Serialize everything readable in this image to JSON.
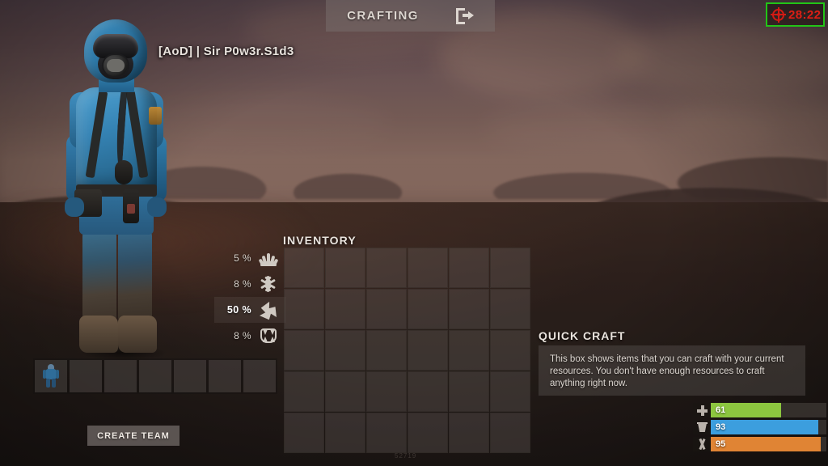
{
  "header": {
    "tab_label": "CRAFTING",
    "exit_icon": "exit-arrow-icon"
  },
  "timer": {
    "value": "28:22",
    "icon": "target-crosshair-icon",
    "text_color": "#e01e14",
    "border_color": "#22c417"
  },
  "player": {
    "name": "[AoD] | Sir P0w3r.S1d3"
  },
  "resistances": [
    {
      "value": "5 %",
      "icon": "heat-burst-icon",
      "highlighted": false
    },
    {
      "value": "8 %",
      "icon": "snowflake-icon",
      "highlighted": false
    },
    {
      "value": "50 %",
      "icon": "radiation-icon",
      "highlighted": true
    },
    {
      "value": "8 %",
      "icon": "bite-fangs-icon",
      "highlighted": false
    }
  ],
  "hotbar": {
    "slots": [
      {
        "item": "hazmat-suit"
      },
      {
        "item": null
      },
      {
        "item": null
      },
      {
        "item": null
      },
      {
        "item": null
      },
      {
        "item": null
      },
      {
        "item": null
      }
    ]
  },
  "team": {
    "create_label": "CREATE TEAM"
  },
  "inventory": {
    "title": "INVENTORY",
    "columns": 6,
    "rows": 5,
    "slots": [
      null,
      null,
      null,
      null,
      null,
      null,
      null,
      null,
      null,
      null,
      null,
      null,
      null,
      null,
      null,
      null,
      null,
      null,
      null,
      null,
      null,
      null,
      null,
      null,
      null,
      null,
      null,
      null,
      null,
      null
    ]
  },
  "quick_craft": {
    "title": "QUICK CRAFT",
    "message": "This box shows items that you can craft with your current resources. You don't have enough resources to craft anything right now."
  },
  "vitals": [
    {
      "name": "health",
      "icon": "plus-icon",
      "value": "61",
      "percent": 61,
      "color": "#8cc63f"
    },
    {
      "name": "hydration",
      "icon": "water-cup-icon",
      "value": "93",
      "percent": 93,
      "color": "#3c9ede"
    },
    {
      "name": "food",
      "icon": "fork-knife-icon",
      "value": "95",
      "percent": 95,
      "color": "#e08434"
    }
  ],
  "watermark": {
    "text": "52719"
  }
}
